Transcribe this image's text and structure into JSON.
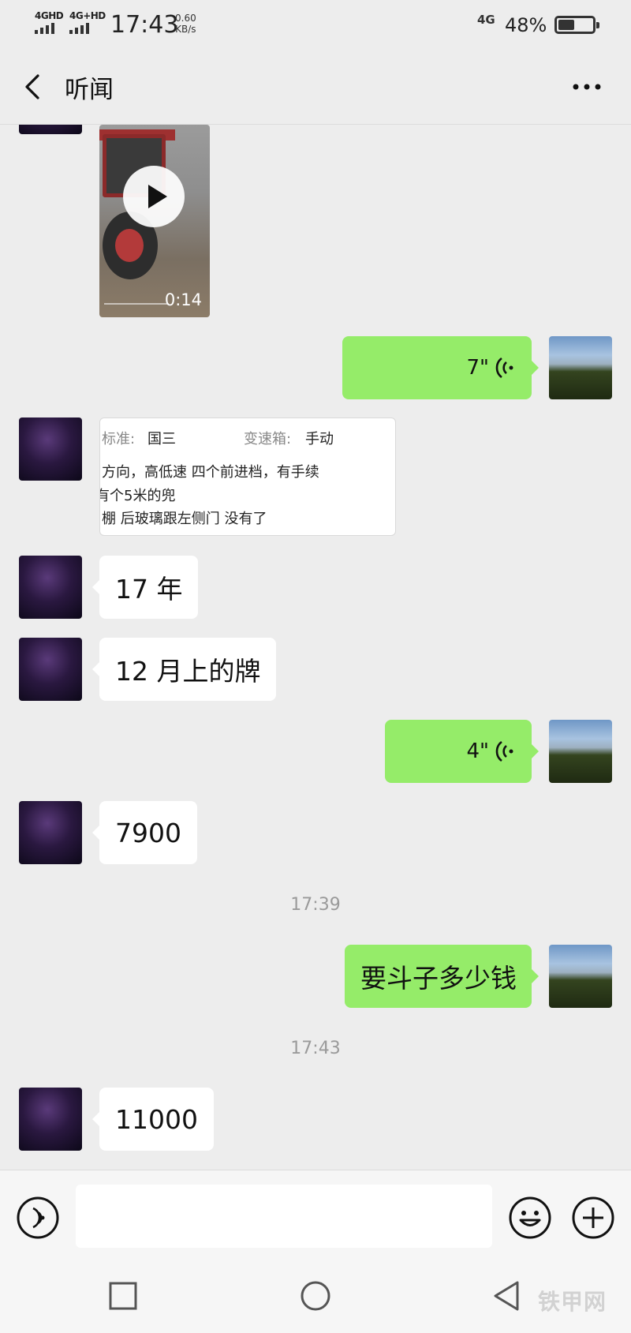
{
  "status_bar": {
    "net1": "4GHD",
    "net2": "4G+HD",
    "time": "17:43",
    "speed_value": "0.60",
    "speed_unit": "KB/s",
    "network": "4G",
    "battery": "48%",
    "battery_level": 0.48
  },
  "header": {
    "title": "听闻",
    "back_icon": "chevron-left-icon",
    "more_icon": "more-dots-icon"
  },
  "video_message": {
    "duration": "0:14",
    "icon": "play-icon"
  },
  "voice_messages": [
    {
      "duration": "7\""
    },
    {
      "duration": "4\""
    }
  ],
  "spec_image": {
    "row1_label1": "标准:",
    "row1_value1": "国三",
    "row1_label2": "变速箱:",
    "row1_value2": "手动",
    "line2": "方向，高低速  四个前进档，有手续",
    "line3": "有个5米的兜",
    "line4": "棚 后玻璃跟左侧门 没有了"
  },
  "messages": [
    {
      "text": "17 年"
    },
    {
      "text": "12 月上的牌"
    },
    {
      "text": "7900"
    },
    {
      "text": "要斗子多少钱"
    },
    {
      "text": "11000"
    }
  ],
  "timestamps": [
    "17:39",
    "17:43"
  ],
  "input_bar": {
    "placeholder": "",
    "voice_icon": "voice-mode-icon",
    "emoji_icon": "emoji-icon",
    "plus_icon": "plus-icon"
  },
  "watermark": "铁甲网"
}
